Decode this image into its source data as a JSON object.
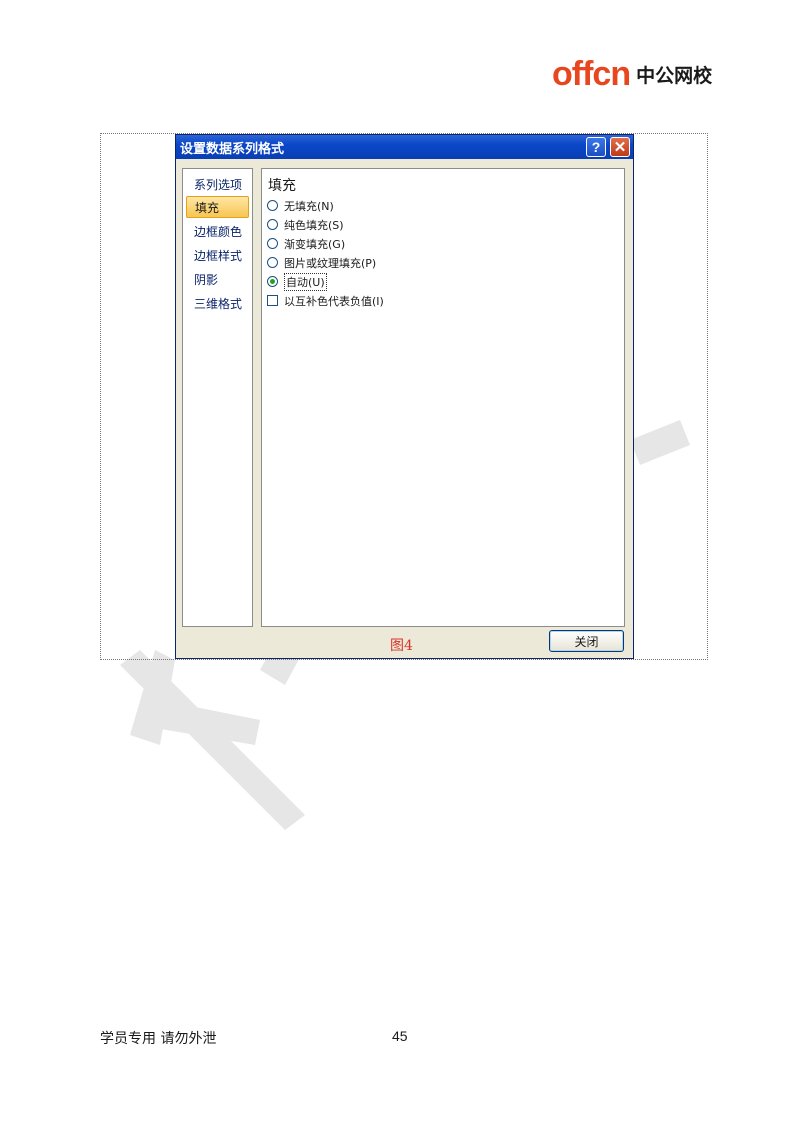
{
  "header": {
    "logo_latin": "offcn",
    "logo_cn": "中公网校"
  },
  "dialog": {
    "title": "设置数据系列格式",
    "help_icon": "?",
    "close_icon": "✕",
    "nav_items": [
      {
        "label": "系列选项"
      },
      {
        "label": "填充"
      },
      {
        "label": "边框颜色"
      },
      {
        "label": "边框样式"
      },
      {
        "label": "阴影"
      },
      {
        "label": "三维格式"
      }
    ],
    "selected_nav": "填充",
    "section_title": "填充",
    "options": [
      {
        "label": "无填充(N)",
        "checked": false
      },
      {
        "label": "纯色填充(S)",
        "checked": false
      },
      {
        "label": "渐变填充(G)",
        "checked": false
      },
      {
        "label": "图片或纹理填充(P)",
        "checked": false
      },
      {
        "label": "自动(U)",
        "checked": true
      }
    ],
    "checkbox": {
      "label": "以互补色代表负值(I)",
      "checked": false
    },
    "close_button": "关闭"
  },
  "figure_caption": "图4",
  "footer": {
    "left": "学员专用 请勿外泄",
    "page_number": "45"
  },
  "colors": {
    "brand": "#e8461e",
    "titlebar": "#0a47c8",
    "caption": "#d9342b"
  }
}
